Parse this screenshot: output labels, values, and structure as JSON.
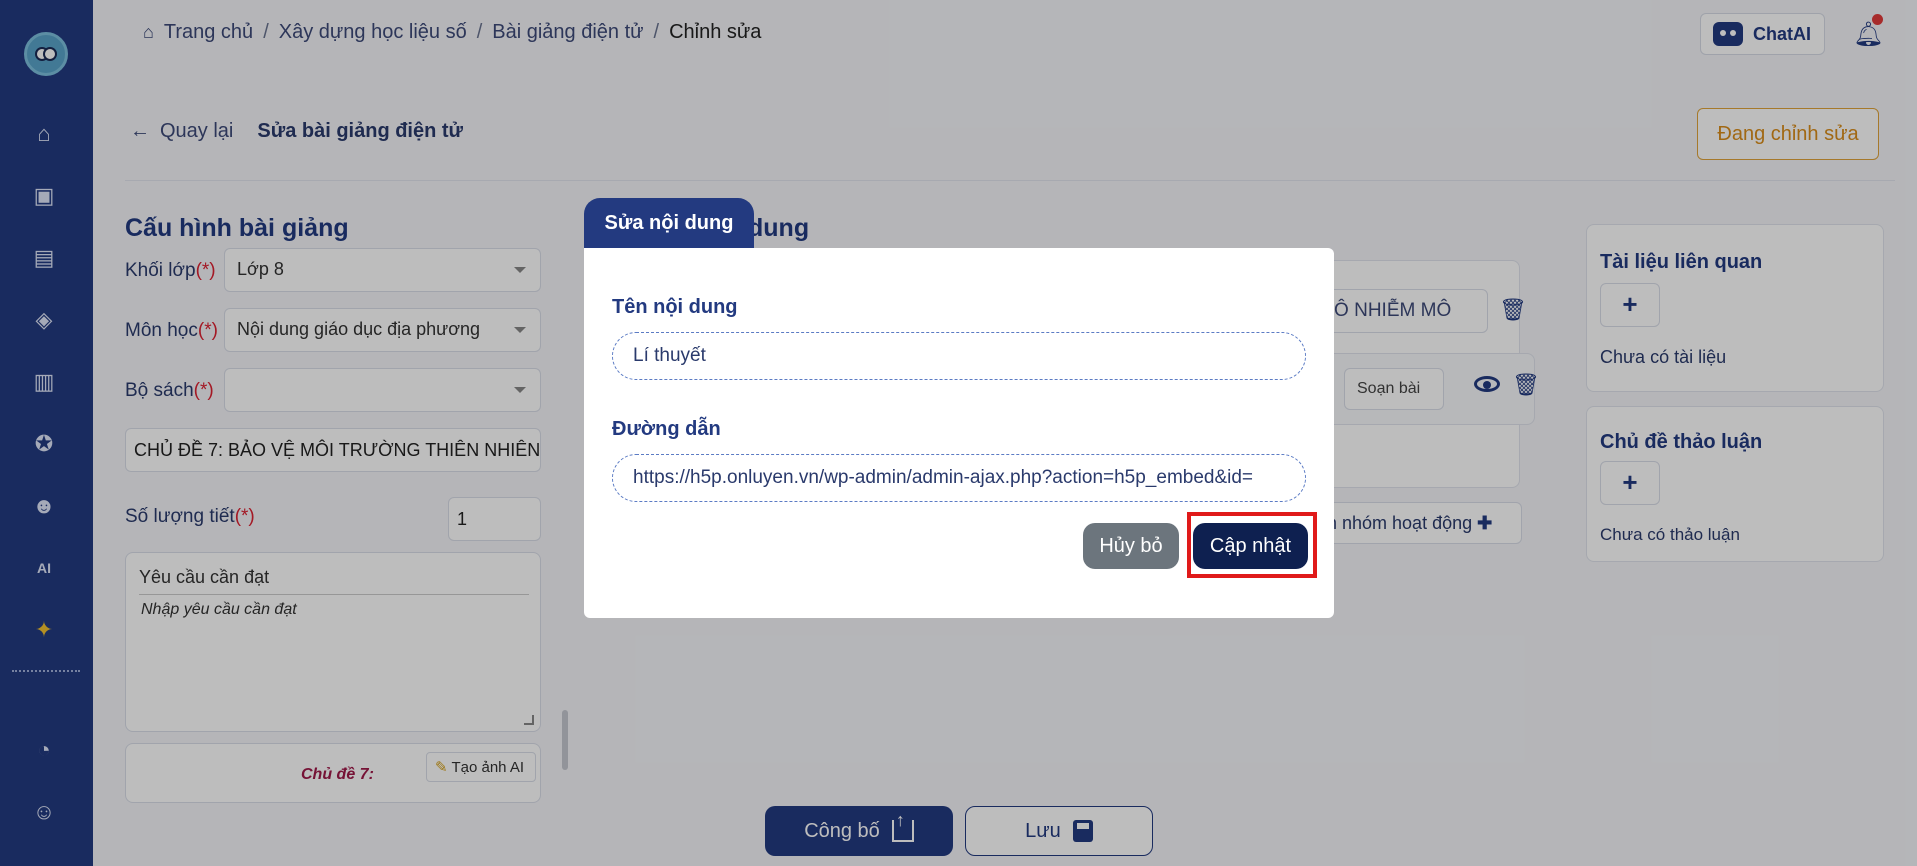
{
  "colors": {
    "primary": "#233a80",
    "accent": "#d98d1a",
    "danger_highlight": "#e01a1a"
  },
  "breadcrumb": [
    "Trang chủ",
    "Xây dựng học liệu số",
    "Bài giảng điện tử",
    "Chỉnh sửa"
  ],
  "header": {
    "chatai_label": "ChatAI"
  },
  "nav": {
    "back_label": "Quay lại",
    "page_title": "Sửa bài giảng điện tử",
    "status_label": "Đang chỉnh sửa"
  },
  "config": {
    "title": "Cấu hình bài giảng",
    "grade_label": "Khối lớp",
    "grade_value": "Lớp 8",
    "subject_label": "Môn học",
    "subject_value": "Nội dung giáo dục địa phương",
    "book_label": "Bộ sách",
    "book_value": "",
    "required_mark": "(*)",
    "topic_value": "CHỦ ĐỀ 7: BẢO VỆ MÔI TRƯỜNG THIÊN NHIÊN",
    "lessons_label": "Số lượng tiết",
    "lessons_value": "1",
    "requirement_title": "Yêu cầu cần đạt",
    "requirement_placeholder": "Nhập yêu cầu cần đạt",
    "thumbnail_text": "Chủ đề 7:",
    "ai_image_label": "Tạo ảnh AI"
  },
  "content": {
    "title_partial": "dung",
    "group_name_visible": "G Ô NHIỄM MÔ",
    "compose_label": "Soạn bài",
    "add_group_label": "Thêm nhóm hoạt động"
  },
  "related": {
    "docs_title": "Tài liệu liên quan",
    "docs_empty": "Chưa có tài liệu",
    "topics_title": "Chủ đề thảo luận",
    "topics_empty": "Chưa có thảo luận"
  },
  "footer": {
    "publish_label": "Công bố",
    "save_label": "Lưu"
  },
  "modal": {
    "tab_label": "Sửa nội dung",
    "name_label": "Tên nội dung",
    "name_value": "Lí thuyết",
    "url_label": "Đường dẫn",
    "url_value": "https://h5p.onluyen.vn/wp-admin/admin-ajax.php?action=h5p_embed&id=",
    "cancel_label": "Hủy bỏ",
    "update_label": "Cập nhật"
  }
}
